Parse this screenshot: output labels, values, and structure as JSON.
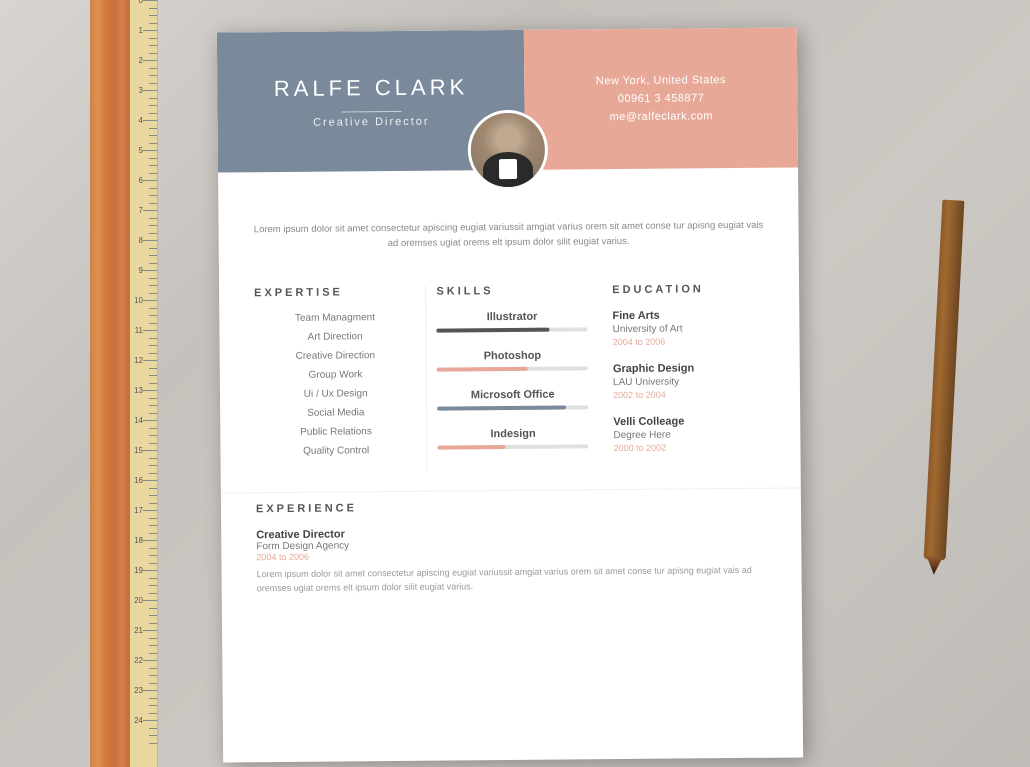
{
  "background": {
    "color": "#c8c4be"
  },
  "resume": {
    "header": {
      "name": "RALFE CLARK",
      "title": "Creative Director",
      "location": "New York, United States",
      "phone": "00961 3 458877",
      "email": "me@ralfeclark.com",
      "left_bg": "#7a8a9a",
      "right_bg": "#e8a898"
    },
    "bio": "Lorem ipsum dolor sit amet consectetur apiscing eugiat variussit amgiat varius orem sit amet conse tur apisng eugiat vais ad oremses ugiat orems elt ipsum dolor silit eugiat varius.",
    "sections": {
      "expertise": {
        "title": "EXPERTISE",
        "items": [
          "Team Managment",
          "Art Direction",
          "Creative Direction",
          "Group Work",
          "Ui / Ux Design",
          "Social Media",
          "Public Relations",
          "Quality Control"
        ]
      },
      "skills": {
        "title": "SKILLS",
        "items": [
          {
            "name": "Illustrator",
            "fill": 75,
            "color": "#555"
          },
          {
            "name": "Photoshop",
            "fill": 60,
            "color": "#e8a898"
          },
          {
            "name": "Microsoft Office",
            "fill": 85,
            "color": "#7a8a9a"
          },
          {
            "name": "Indesign",
            "fill": 45,
            "color": "#e8a898"
          }
        ]
      },
      "education": {
        "title": "EDUCATION",
        "items": [
          {
            "degree": "Fine Arts",
            "school": "University of Art",
            "year": "2004 to 2006"
          },
          {
            "degree": "Graphic Design",
            "school": "LAU University",
            "year": "2002 to 2004"
          },
          {
            "degree": "Velli Colleage",
            "school": "Degree Here",
            "year": "2000 to 2002"
          }
        ]
      },
      "experience": {
        "title": "EXPERIENCE",
        "items": [
          {
            "position": "Creative Director",
            "company": "Form Design Agency",
            "year": "2004 to 2006",
            "description": "Lorem ipsum dolor sit amet consectetur apiscing eugiat variussit amgiat varius orem sit amet conse tur apisng eugiat vais ad oremses ugiat orems elt ipsum dolor silit eugiat varius."
          }
        ]
      }
    }
  }
}
